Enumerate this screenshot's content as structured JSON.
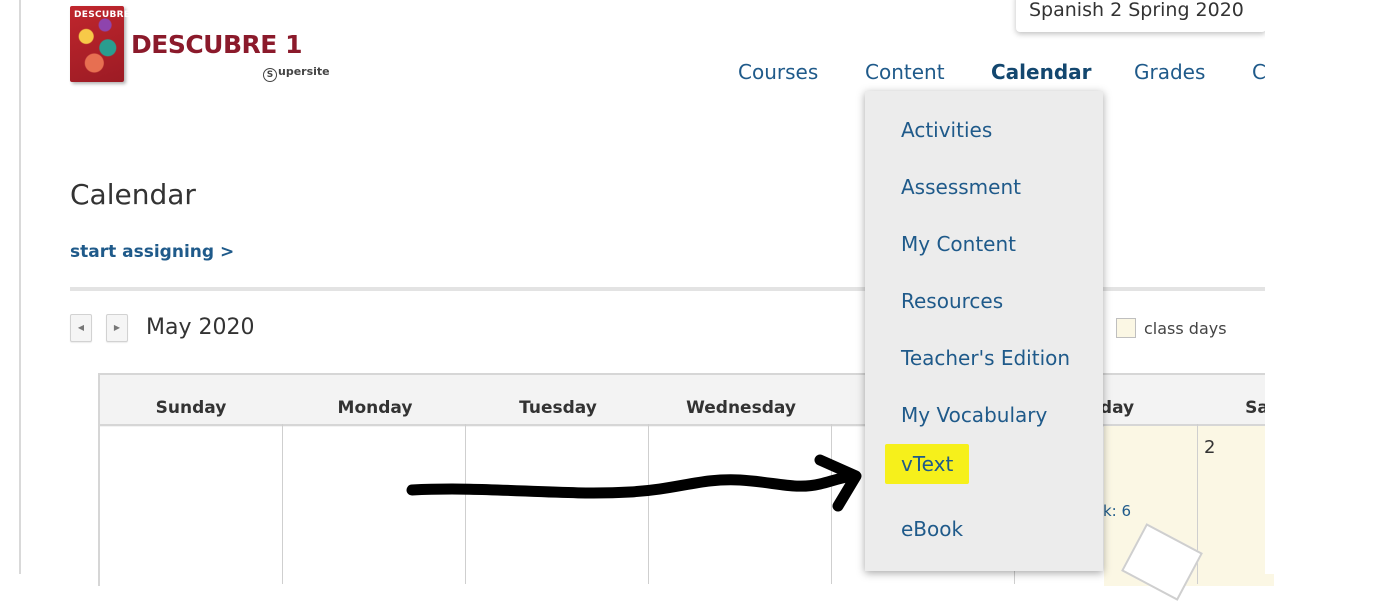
{
  "logo": {
    "book_title": "DESCUBRE",
    "brand": "DESCUBRE 1",
    "supersite_mark": "S",
    "supersite": "upersite"
  },
  "course": {
    "name": "Spanish 2 Spring 2020"
  },
  "nav": [
    {
      "label": "Courses"
    },
    {
      "label": "Content"
    },
    {
      "label": "Calendar",
      "active": true
    },
    {
      "label": "Grades"
    },
    {
      "label": "C"
    }
  ],
  "page": {
    "title": "Calendar",
    "start_link": "start assigning >"
  },
  "calendar": {
    "month": "May 2020",
    "prev_icon": "◀",
    "next_icon": "▶",
    "legend": "class days",
    "days": [
      "Sunday",
      "Monday",
      "Tuesday",
      "Wednesday",
      "",
      "day",
      "Sa"
    ],
    "visible_date": "2",
    "item_fragment": "k: 6"
  },
  "dropdown": {
    "items": [
      {
        "label": "Activities"
      },
      {
        "label": "Assessment"
      },
      {
        "label": "My Content"
      },
      {
        "label": "Resources"
      },
      {
        "label": "Teacher's Edition"
      },
      {
        "label": "My Vocabulary"
      },
      {
        "label": "vText",
        "highlighted": true
      },
      {
        "label": "eBook"
      }
    ]
  },
  "colors": {
    "link": "#1f5a8a",
    "brand": "#8b1a2b",
    "highlight": "#f6f01b",
    "class_day": "#fbf7e4"
  }
}
